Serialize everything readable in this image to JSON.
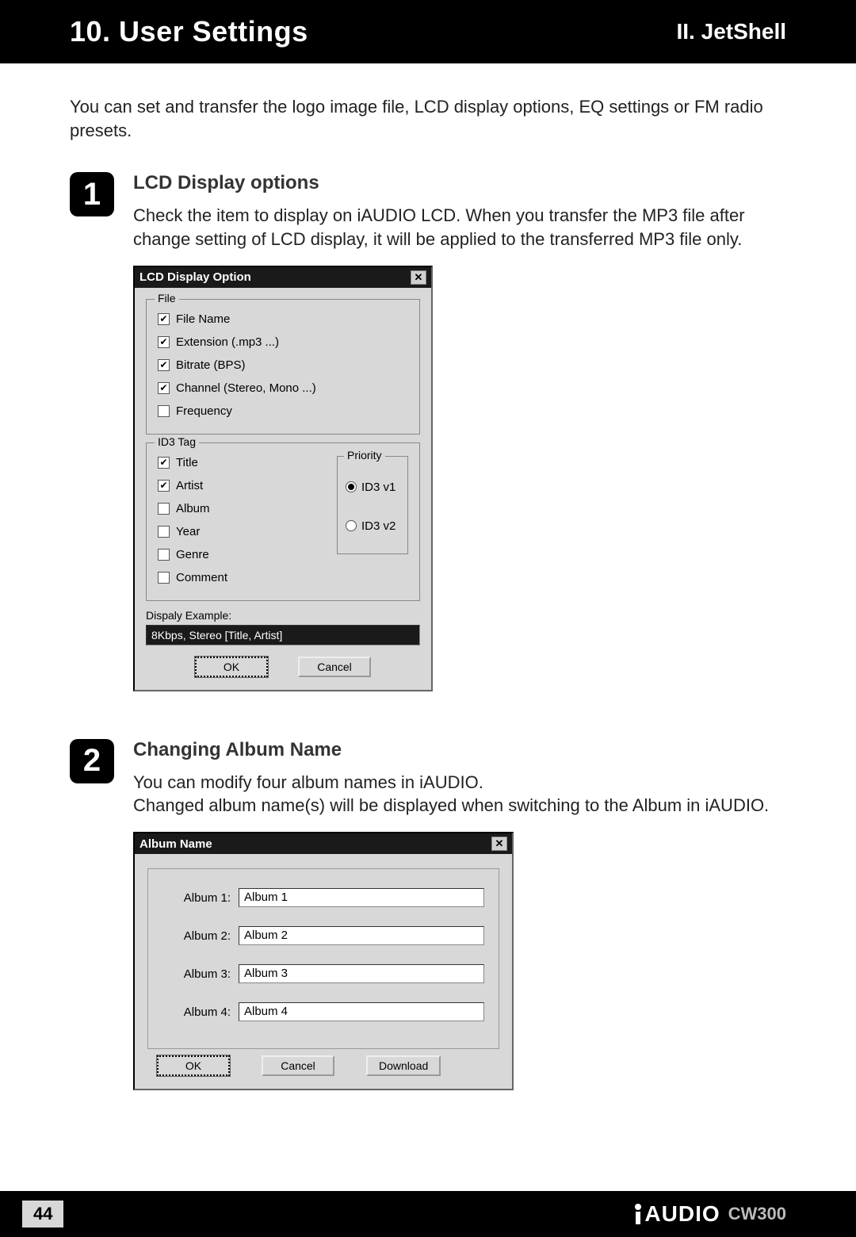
{
  "header": {
    "title": "10. User Settings",
    "breadcrumb": "II. JetShell"
  },
  "intro": "You can set and transfer the logo image file, LCD display options, EQ settings or FM radio presets.",
  "section1": {
    "badge": "1",
    "title": "LCD Display options",
    "desc": "Check the item to display on iAUDIO LCD. When you transfer the MP3 file after change setting of LCD display, it will be applied to the transferred MP3 file only."
  },
  "lcdDialog": {
    "title": "LCD Display Option",
    "close": "✕",
    "fileGroup": {
      "legend": "File",
      "items": [
        {
          "label": "File Name",
          "checked": true
        },
        {
          "label": "Extension (.mp3 ...)",
          "checked": true
        },
        {
          "label": "Bitrate (BPS)",
          "checked": true
        },
        {
          "label": "Channel (Stereo, Mono ...)",
          "checked": true
        },
        {
          "label": "Frequency",
          "checked": false
        }
      ]
    },
    "id3Group": {
      "legend": "ID3 Tag",
      "items": [
        {
          "label": "Title",
          "checked": true
        },
        {
          "label": "Artist",
          "checked": true
        },
        {
          "label": "Album",
          "checked": false
        },
        {
          "label": "Year",
          "checked": false
        },
        {
          "label": "Genre",
          "checked": false
        },
        {
          "label": "Comment",
          "checked": false
        }
      ],
      "priority": {
        "legend": "Priority",
        "options": [
          {
            "label": "ID3 v1",
            "selected": true
          },
          {
            "label": "ID3 v2",
            "selected": false
          }
        ]
      }
    },
    "exampleLabel": "Dispaly Example:",
    "exampleValue": "8Kbps, Stereo [Title, Artist]",
    "okLabel": "OK",
    "cancelLabel": "Cancel"
  },
  "section2": {
    "badge": "2",
    "title": "Changing Album Name",
    "desc1": "You can modify four album names in iAUDIO.",
    "desc2": "Changed album name(s) will be displayed when switching to the Album in iAUDIO."
  },
  "albumDialog": {
    "title": "Album Name",
    "close": "✕",
    "rows": [
      {
        "label": "Album 1:",
        "value": "Album 1"
      },
      {
        "label": "Album 2:",
        "value": "Album 2"
      },
      {
        "label": "Album 3:",
        "value": "Album 3"
      },
      {
        "label": "Album 4:",
        "value": "Album 4"
      }
    ],
    "okLabel": "OK",
    "cancelLabel": "Cancel",
    "downloadLabel": "Download"
  },
  "footer": {
    "page": "44",
    "brandText": "AUDIO",
    "model": "CW300"
  }
}
